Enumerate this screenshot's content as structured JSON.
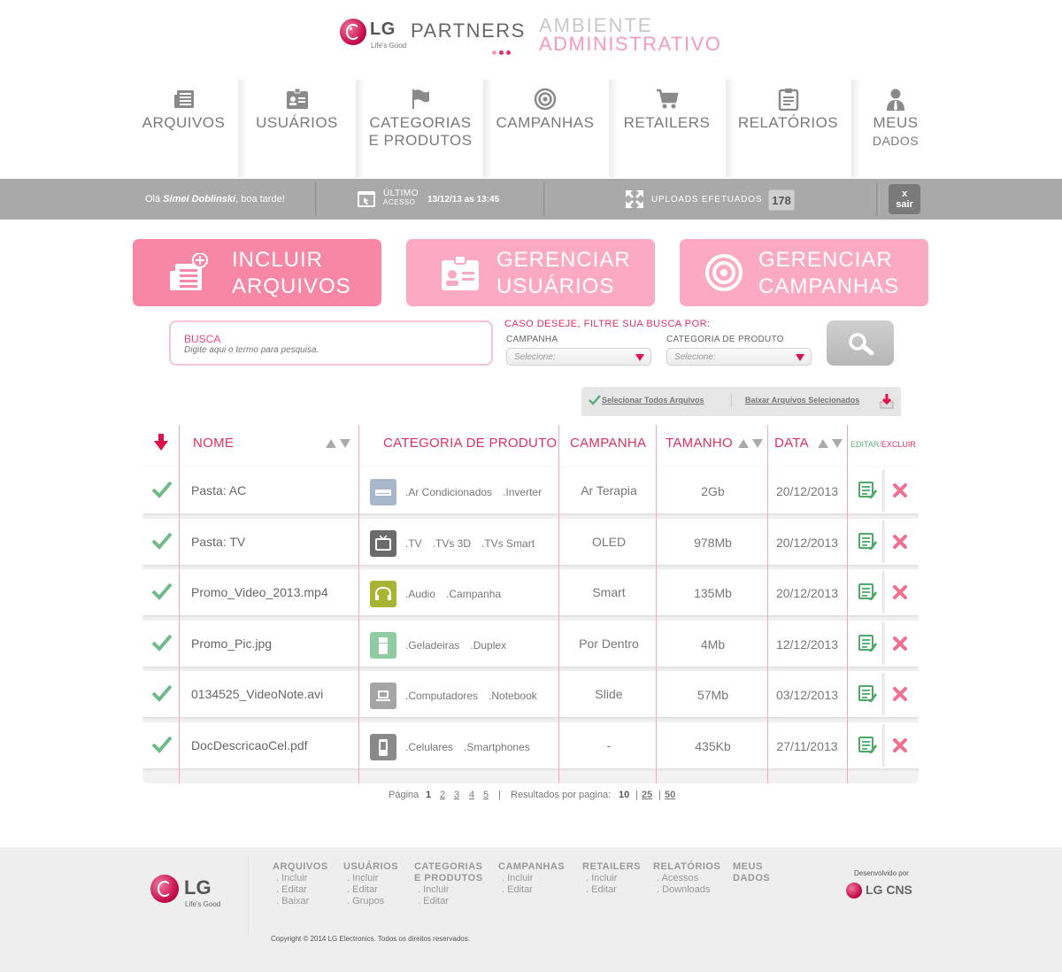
{
  "header": {
    "brand": "LG",
    "tagline": "Life's Good",
    "product": "PARTNERS",
    "title_line1": "AMBIENTE",
    "title_line2": "ADMINISTRATIVO",
    "dot_colors": [
      "#f59bb8",
      "#e0305e",
      "#e0305e"
    ]
  },
  "nav": [
    {
      "label": "ARQUIVOS",
      "label2": "",
      "icon": "newspaper-icon"
    },
    {
      "label": "USUÁRIOS",
      "label2": "",
      "icon": "id-card-icon"
    },
    {
      "label": "CATEGORIAS",
      "label2": "E PRODUTOS",
      "icon": "flag-icon"
    },
    {
      "label": "CAMPANHAS",
      "label2": "",
      "icon": "target-icon"
    },
    {
      "label": "RETAILERS",
      "label2": "",
      "icon": "cart-icon"
    },
    {
      "label": "RELATÓRIOS",
      "label2": "",
      "icon": "clipboard-icon"
    },
    {
      "label": "MEUS",
      "label2": "DADOS",
      "icon": "user-icon"
    }
  ],
  "status": {
    "greeting_prefix": "Olá ",
    "user": "Simei Doblinski",
    "greeting_suffix": ", boa tarde!",
    "last_access_l1": "ÚLTIMO",
    "last_access_l2": "ACESSO",
    "last_access_value": "13/12/13 as 13:45",
    "uploads_label": "UPLOADS EFETUADOS",
    "uploads_count": "178",
    "exit_x": "x",
    "exit_label": "sair"
  },
  "actions": [
    {
      "l1": "INCLUIR",
      "l2": "ARQUIVOS",
      "color": "#f887a6",
      "icon": "add-file-icon"
    },
    {
      "l1": "GERENCIAR",
      "l2": "USUÁRIOS",
      "color": "#fbaac1",
      "icon": "id-card-icon"
    },
    {
      "l1": "GERENCIAR",
      "l2": "CAMPANHAS",
      "color": "#fbaac1",
      "icon": "target-icon"
    }
  ],
  "search": {
    "label": "BUSCA",
    "placeholder": "Digite aqui o termo para pesquisa.",
    "filter_title": "CASO DESEJE, FILTRE SUA BUSCA POR:",
    "campaign_label": "CAMPANHA",
    "campaign_value": "Selecione:",
    "category_label": "CATEGORIA DE PRODUTO",
    "category_value": "Selecione:"
  },
  "toolbar": {
    "select_all": "Selecionar Todos Arquivos",
    "download_selected": "Baixar Arquivos Selecionados"
  },
  "table": {
    "headers": {
      "name": "NOME",
      "category": "CATEGORIA DE PRODUTO",
      "campaign": "CAMPANHA",
      "size": "TAMANHO",
      "date": "DATA",
      "edit": "EDITAR",
      "slash": "/",
      "delete": "EXCLUIR"
    },
    "rows": [
      {
        "name": "Pasta: AC",
        "cats": [
          ".Ar Condicionados",
          ".Inverter",
          ""
        ],
        "cat_color": "#a9b7cc",
        "cat_icon": "air-conditioner-icon",
        "campaign": "Ar Terapia",
        "size": "2Gb",
        "date": "20/12/2013"
      },
      {
        "name": "Pasta: TV",
        "cats": [
          ".TV",
          ".TVs 3D",
          ".TVs Smart"
        ],
        "cat_color": "#6b6b6b",
        "cat_icon": "tv-icon",
        "campaign": "OLED",
        "size": "978Mb",
        "date": "20/12/2013"
      },
      {
        "name": "Promo_Video_2013.mp4",
        "cats": [
          ".Audio",
          ".Campanha",
          ""
        ],
        "cat_color": "#a9b532",
        "cat_icon": "headphones-icon",
        "campaign": "Smart",
        "size": "135Mb",
        "date": "20/12/2013"
      },
      {
        "name": "Promo_Pic.jpg",
        "cats": [
          ".Geladeiras",
          ".Duplex",
          ""
        ],
        "cat_color": "#8fcaa1",
        "cat_icon": "fridge-icon",
        "campaign": "Por Dentro",
        "size": "4Mb",
        "date": "12/12/2013"
      },
      {
        "name": "0134525_VideoNote.avi",
        "cats": [
          ".Computadores",
          ".Notebook",
          ""
        ],
        "cat_color": "#a5a5a5",
        "cat_icon": "laptop-icon",
        "campaign": "Slide",
        "size": "57Mb",
        "date": "03/12/2013"
      },
      {
        "name": "DocDescricaoCel.pdf",
        "cats": [
          ".Celulares",
          ".Smartphones",
          ""
        ],
        "cat_color": "#8a8a8a",
        "cat_icon": "phone-icon",
        "campaign": "-",
        "size": "435Kb",
        "date": "27/11/2013"
      }
    ]
  },
  "pager": {
    "label": "Página",
    "pages": [
      "1",
      "2",
      "3",
      "4",
      "5"
    ],
    "current": "1",
    "sep": "|",
    "per_page_label": "Resultados por pagina:",
    "per_page": [
      "10",
      "25",
      "50"
    ],
    "per_page_seps": [
      "|",
      "|"
    ]
  },
  "footer": {
    "brand": "LG",
    "tagline": "Life's Good",
    "columns": [
      {
        "h1": "ARQUIVOS",
        "h2": "",
        "items": [
          ". Incluir",
          ". Editar",
          ". Baixar"
        ]
      },
      {
        "h1": "USUÁRIOS",
        "h2": "",
        "items": [
          ". Incluir",
          ". Editar",
          ". Grupos"
        ]
      },
      {
        "h1": "CATEGORIAS",
        "h2": "E PRODUTOS",
        "items": [
          ". Incluir",
          ". Editar"
        ]
      },
      {
        "h1": "CAMPANHAS",
        "h2": "",
        "items": [
          ". Incluir",
          ". Editar"
        ]
      },
      {
        "h1": "RETAILERS",
        "h2": "",
        "items": [
          ". Incluir",
          ". Editar"
        ]
      },
      {
        "h1": "RELATÓRIOS",
        "h2": "",
        "items": [
          ". Acessos",
          ". Downloads"
        ]
      },
      {
        "h1": "MEUS",
        "h2": "DADOS",
        "items": []
      }
    ],
    "developed_by": "Desenvolvido por",
    "dev_brand": "LG CNS",
    "copyright": "Copyright © 2014 LG Electronics. Todos os direitos reservados."
  }
}
